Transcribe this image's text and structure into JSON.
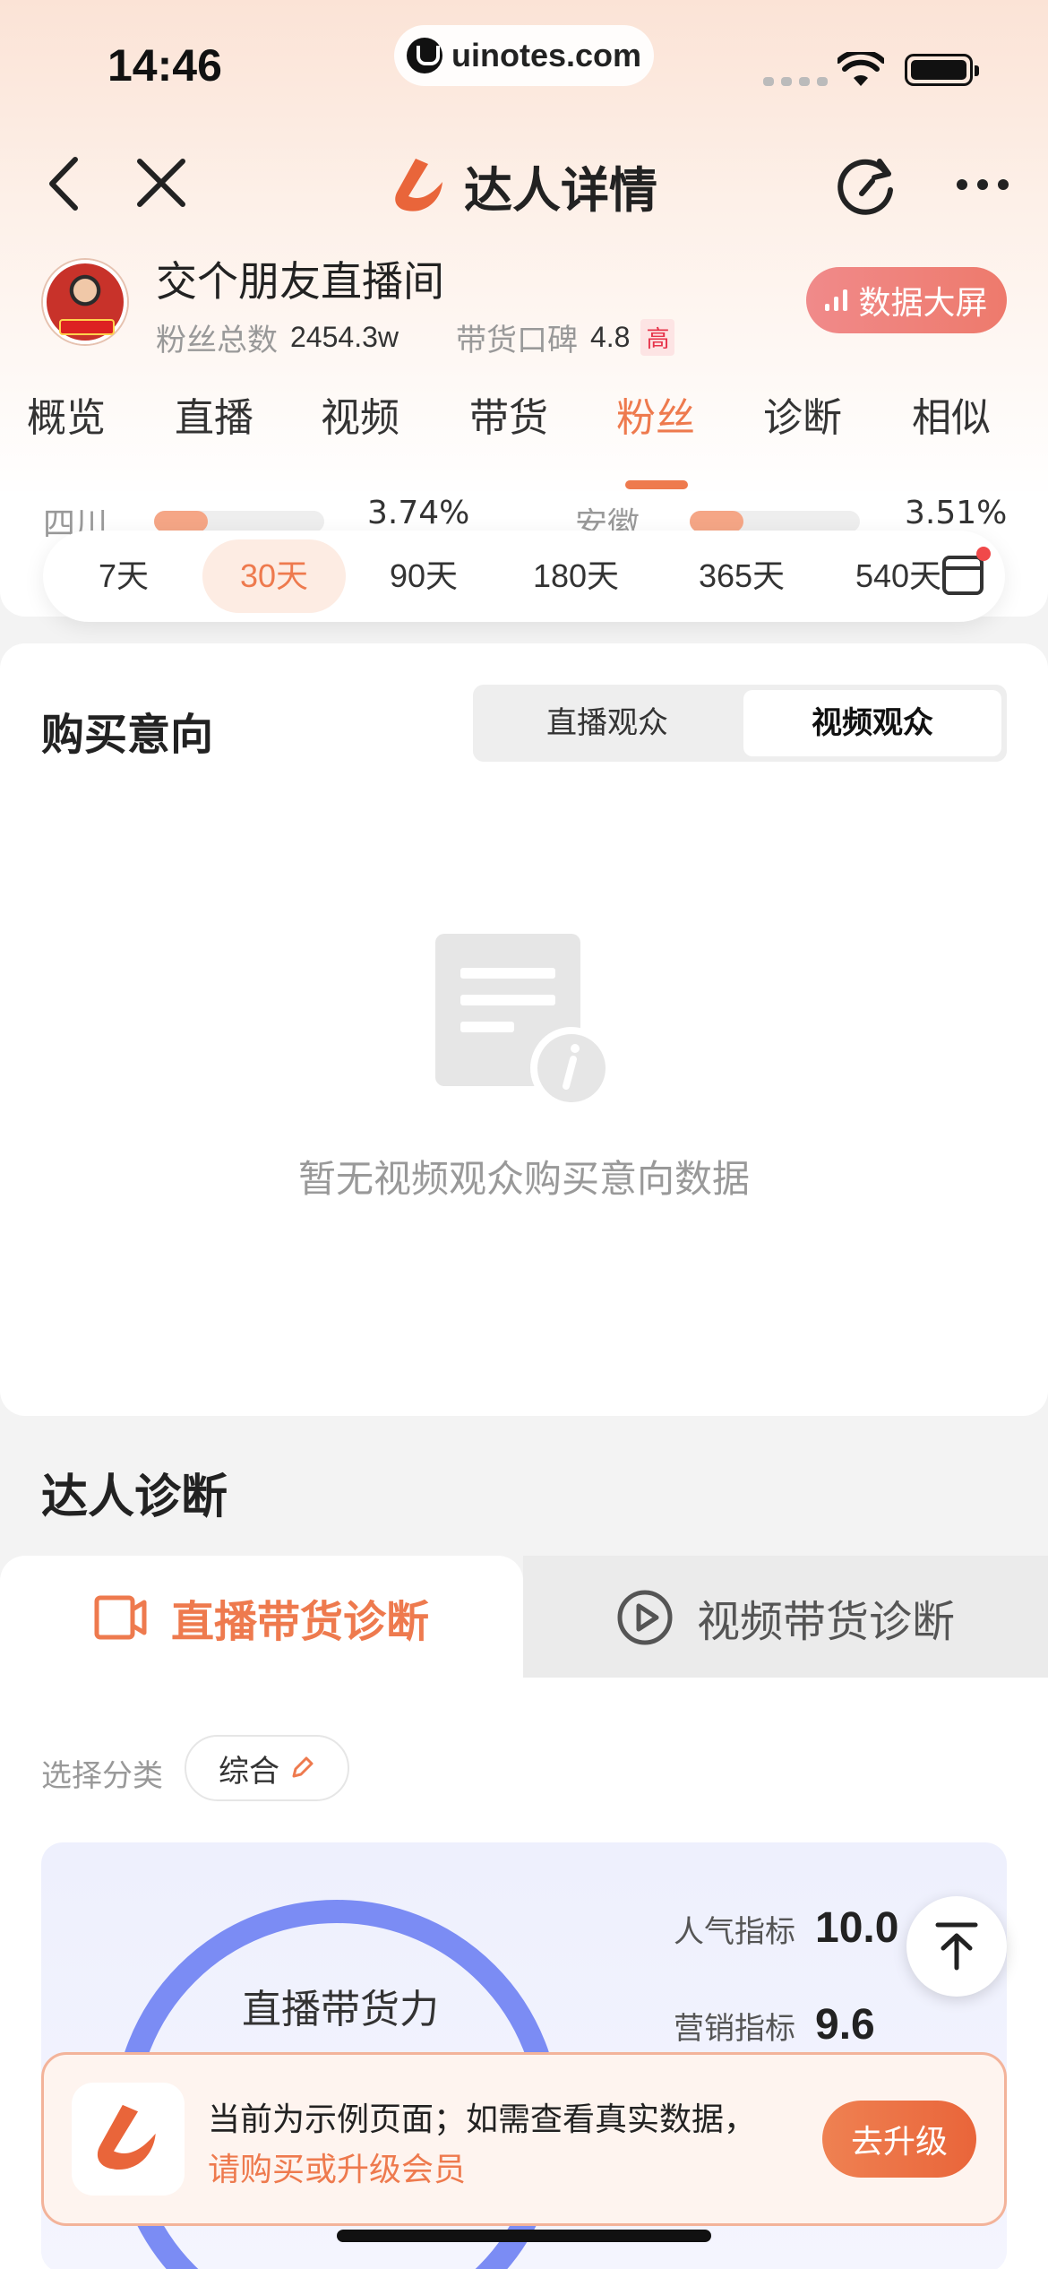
{
  "status_bar": {
    "time": "14:46",
    "url": "uinotes.com"
  },
  "nav": {
    "title": "达人详情"
  },
  "profile": {
    "name": "交个朋友直播间",
    "fans_label": "粉丝总数",
    "fans_value": "2454.3w",
    "reputation_label": "带货口碑",
    "reputation_value": "4.8",
    "reputation_level": "高",
    "big_screen_label": "数据大屏"
  },
  "tabs": [
    "概览",
    "直播",
    "视频",
    "带货",
    "粉丝",
    "诊断",
    "相似"
  ],
  "active_tab": "粉丝",
  "partial_row": {
    "left_label": "四川",
    "left_value": "3.74%",
    "right_label": "安徽",
    "right_value": "3.51%"
  },
  "day_range": {
    "options": [
      "7天",
      "30天",
      "90天",
      "180天",
      "365天",
      "540天"
    ],
    "active": "30天"
  },
  "purchase_intent": {
    "title": "购买意向",
    "segments": [
      "直播观众",
      "视频观众"
    ],
    "active_segment": "视频观众",
    "empty_text": "暂无视频观众购买意向数据"
  },
  "diagnosis": {
    "title": "达人诊断",
    "tabs": [
      "直播带货诊断",
      "视频带货诊断"
    ],
    "active_tab": "直播带货诊断",
    "category_label": "选择分类",
    "category_value": "综合",
    "gauge_label": "直播带货力",
    "metrics": [
      {
        "label": "人气指标",
        "value": "10.0"
      },
      {
        "label": "营销指标",
        "value": "9.6"
      }
    ]
  },
  "banner": {
    "line1": "当前为示例页面；如需查看真实数据，",
    "line2": "请购买或升级会员",
    "button": "去升级"
  },
  "colors": {
    "accent": "#ee7a4e",
    "gauge": "#7b8cf4",
    "badge_red": "#e6334a"
  }
}
